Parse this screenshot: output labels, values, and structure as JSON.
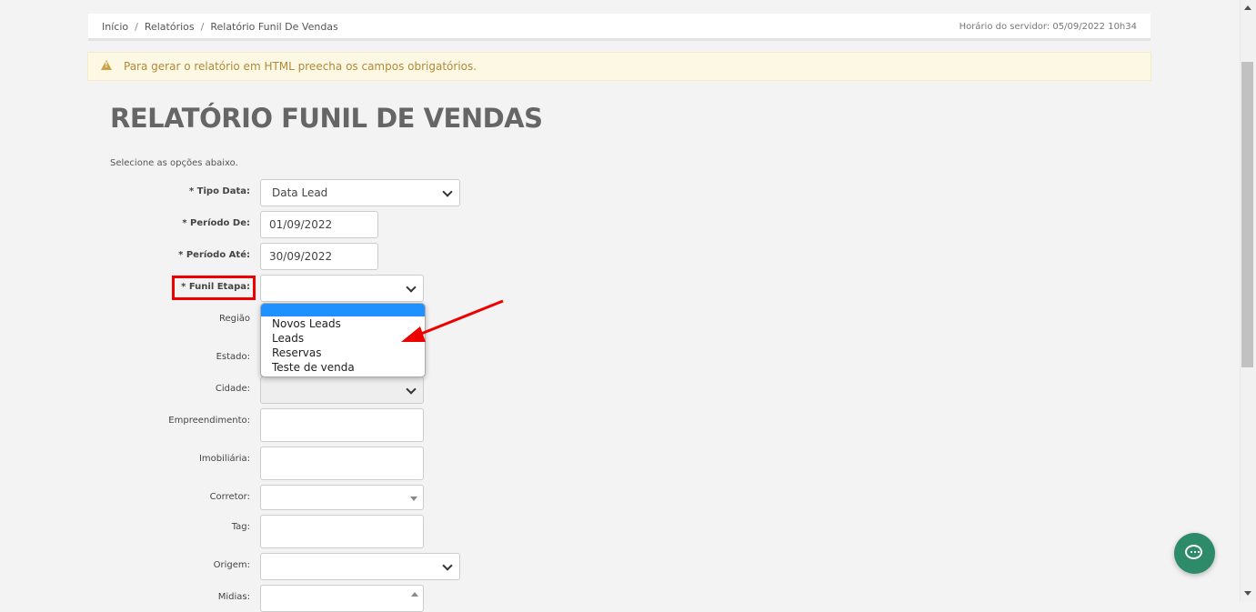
{
  "breadcrumb": {
    "items": [
      "Início",
      "Relatórios",
      "Relatório Funil De Vendas"
    ],
    "separator": "/"
  },
  "server_time": "Horário do servidor: 05/09/2022 10h34",
  "alert": {
    "icon": "warning-icon",
    "message": "Para gerar o relatório em HTML preecha os campos obrigatórios."
  },
  "page": {
    "title": "RELATÓRIO FUNIL DE VENDAS",
    "intro": "Selecione as opções abaixo."
  },
  "form": {
    "tipo_data": {
      "label": "* Tipo Data:",
      "value": "Data Lead"
    },
    "periodo_de": {
      "label": "* Período De:",
      "value": "01/09/2022"
    },
    "periodo_ate": {
      "label": "* Período Até:",
      "value": "30/09/2022"
    },
    "funil_etapa": {
      "label": "* Funil Etapa:",
      "value": "",
      "options": [
        "",
        "Novos Leads",
        "Leads",
        "Reservas",
        "Teste de venda"
      ]
    },
    "regiao": {
      "label": "Região"
    },
    "estado": {
      "label": "Estado:"
    },
    "cidade": {
      "label": "Cidade:"
    },
    "empreendimento": {
      "label": "Empreendimento:"
    },
    "imobiliaria": {
      "label": "Imobiliária:"
    },
    "corretor": {
      "label": "Corretor:"
    },
    "tag": {
      "label": "Tag:"
    },
    "origem": {
      "label": "Origem:"
    },
    "midias": {
      "label": "Midias:"
    }
  },
  "colors": {
    "highlight": "#e00000",
    "dropdown_selected": "#1e90ff",
    "chat_button": "#2e8b6a",
    "alert_bg": "#fcf8e3",
    "alert_text": "#b08a3a"
  },
  "chat": {
    "icon": "chat-icon"
  }
}
